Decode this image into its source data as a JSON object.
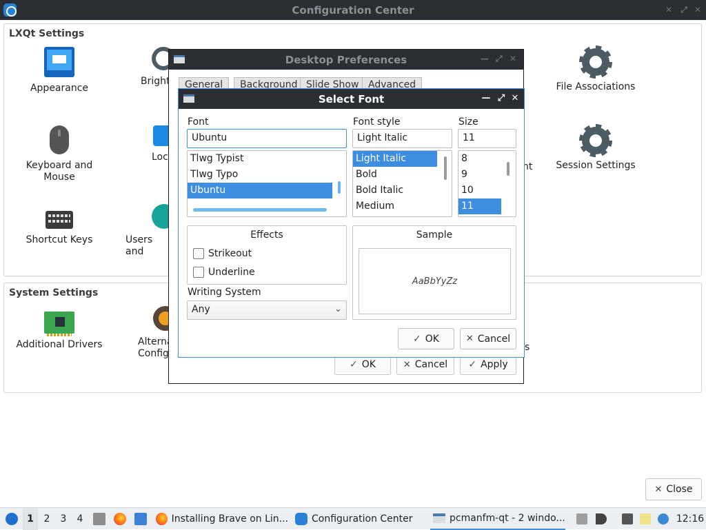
{
  "main_window": {
    "title": "Configuration Center",
    "sections": {
      "lxqt": {
        "title": "LXQt Settings",
        "items": [
          {
            "label": "Appearance",
            "icon": "appearance-icon"
          },
          {
            "label": "Bright",
            "icon": "brightness-icon"
          },
          {
            "label": "File Associations",
            "icon": "gear-icon"
          },
          {
            "label": "Keyboard and\nMouse",
            "icon": "mouse-icon"
          },
          {
            "label": "Loca",
            "icon": "locale-icon"
          },
          {
            "label": "nt",
            "icon": "partial-icon"
          },
          {
            "label": "Session Settings",
            "icon": "gear-icon"
          },
          {
            "label": "Shortcut Keys",
            "icon": "keyboard-icon"
          },
          {
            "label": "Users and",
            "icon": "users-icon"
          }
        ]
      },
      "system": {
        "title": "System Settings",
        "items": [
          {
            "label": "Additional Drivers",
            "icon": "driver-card-icon"
          },
          {
            "label": "Alterna\nConfig",
            "icon": "alternatives-icon"
          },
          {
            "label": "s",
            "icon": "partial-icon"
          }
        ]
      }
    },
    "close_label": "Close"
  },
  "desktop_prefs": {
    "title": "Desktop Preferences",
    "tabs": [
      "General",
      "Background",
      "Slide Show",
      "Advanced"
    ],
    "buttons": {
      "ok": "OK",
      "cancel": "Cancel",
      "apply": "Apply"
    }
  },
  "select_font": {
    "title": "Select Font",
    "font_label": "Font",
    "font_value": "Ubuntu",
    "font_list": [
      "Tlwg Typist",
      "Tlwg Typo",
      "Ubuntu"
    ],
    "font_selected_index": 2,
    "style_label": "Font style",
    "style_value": "Light Italic",
    "style_list": [
      "Light Italic",
      "Bold",
      "Bold Italic",
      "Medium"
    ],
    "style_selected_index": 0,
    "size_label": "Size",
    "size_value": "11",
    "size_list": [
      "8",
      "9",
      "10",
      "11"
    ],
    "size_selected_index": 3,
    "effects_title": "Effects",
    "strikeout_label": "Strikeout",
    "underline_label": "Underline",
    "writing_system_label": "Writing System",
    "writing_system_value": "Any",
    "sample_title": "Sample",
    "sample_text": "AaBbYyZz",
    "ok_label": "OK",
    "cancel_label": "Cancel",
    "accent_color": "#3d8ee0"
  },
  "taskbar": {
    "desktops": [
      "1",
      "2",
      "3",
      "4"
    ],
    "tasks": [
      {
        "label": "Installing Brave on Lin...",
        "icon": "firefox-icon"
      },
      {
        "label": "Configuration Center",
        "icon": "config-center-icon"
      },
      {
        "label": "pcmanfm-qt - 2 windo...",
        "icon": "window-icon"
      }
    ],
    "clock": "12:16"
  }
}
